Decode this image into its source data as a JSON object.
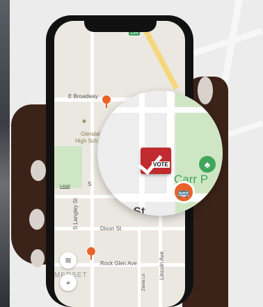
{
  "map": {
    "highway_shield": "134",
    "streets": {
      "e_broadway": "E Broadway",
      "dixon": "Dixon St",
      "rock_glen": "Rock Glen Ave",
      "s_langley": "S Langley St",
      "zinnia": "Zinnia Ln",
      "lincoln": "Lincoln Ave",
      "somerset": "MERSET",
      "colorado_zoom": "rado St"
    },
    "poi": {
      "school": "Glendale High School",
      "school_line1": "Glendal",
      "school_line2": "High Sch",
      "park_zoom": "Carr P"
    },
    "legal": "Legal",
    "legal_partial": "S"
  },
  "magnifier": {
    "vote_label": "VOTE"
  },
  "icons": {
    "bus": "bus-icon",
    "layers": "layers-icon",
    "locate": "locate-icon",
    "tree": "tree-icon",
    "vote": "vote-box-icon"
  },
  "colors": {
    "bus_pin": "#e8622a",
    "park": "#cfe6c4",
    "vote_box": "#c12a2e",
    "park_icon": "#3fa65a"
  }
}
